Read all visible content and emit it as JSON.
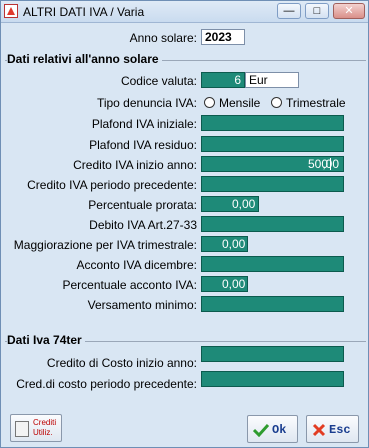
{
  "window": {
    "title": "ALTRI DATI IVA / Varia"
  },
  "anno": {
    "label": "Anno solare:",
    "value": "2023"
  },
  "section1": "Dati relativi all'anno solare",
  "codice_valuta": {
    "label": "Codice valuta:",
    "code": "6",
    "currency": "Eur"
  },
  "tipo_denuncia": {
    "label": "Tipo denuncia IVA:",
    "opt1": "Mensile",
    "opt2": "Trimestrale"
  },
  "plafond_iniziale": {
    "label": "Plafond IVA iniziale:"
  },
  "plafond_residuo": {
    "label": "Plafond IVA residuo:"
  },
  "credito_inizio": {
    "label": "Credito IVA inizio anno:",
    "int": "500",
    "dec": ",00"
  },
  "credito_periodo": {
    "label": "Credito IVA periodo precedente:"
  },
  "percentuale_prorata": {
    "label": "Percentuale prorata:",
    "value": "0,00"
  },
  "debito_iva": {
    "label": "Debito IVA Art.27-33"
  },
  "maggiorazione": {
    "label": "Maggiorazione per IVA trimestrale:",
    "value": "0,00"
  },
  "acconto_dicembre": {
    "label": "Acconto IVA dicembre:"
  },
  "percentuale_acconto": {
    "label": "Percentuale acconto IVA:",
    "value": "0,00"
  },
  "versamento_minimo": {
    "label": "Versamento minimo:"
  },
  "section2": "Dati Iva 74ter",
  "credito_costo_inizio": {
    "label": "Credito di Costo inizio anno:"
  },
  "credito_costo_periodo": {
    "label": "Cred.di costo periodo precedente:"
  },
  "buttons": {
    "crediti_line1": "Crediti",
    "crediti_line2": "Utiliz.",
    "ok": "Ok",
    "esc": "Esc"
  }
}
